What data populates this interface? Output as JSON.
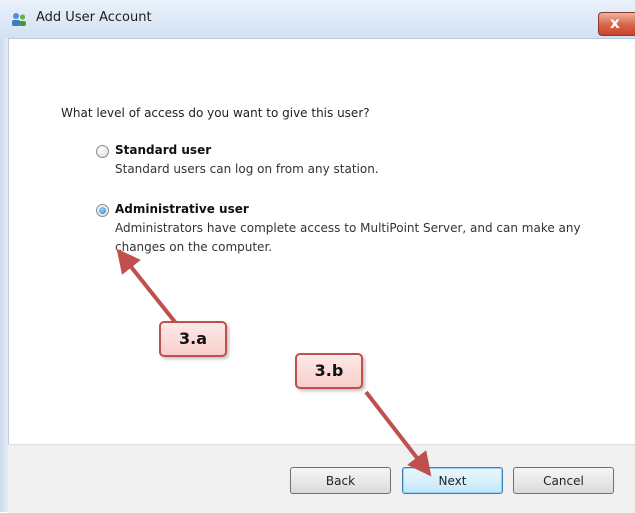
{
  "window": {
    "title": "Add User Account",
    "close_glyph": "x"
  },
  "content": {
    "question": "What level of access do you want to give this user?",
    "options": [
      {
        "title": "Standard user",
        "description": "Standard users can log on from any station.",
        "selected": false
      },
      {
        "title": "Administrative user",
        "description_line1": "Administrators have complete access to MultiPoint Server, and can make any",
        "description_line2": "changes on the computer.",
        "selected": true
      }
    ]
  },
  "buttons": {
    "back": "Back",
    "next": "Next",
    "cancel": "Cancel"
  },
  "annotations": {
    "callout_a": "3.a",
    "callout_b": "3.b",
    "arrow_color": "#c0504d"
  }
}
